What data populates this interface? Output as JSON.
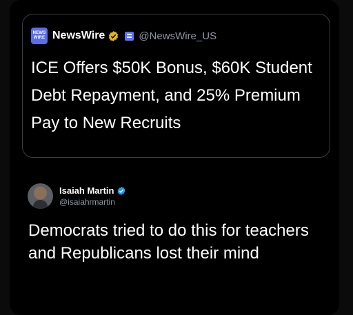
{
  "quoted_post": {
    "logo_text_top": "NEWS",
    "logo_text_bottom": "WIRE",
    "account_name": "NewsWire",
    "handle": "@NewsWire_US",
    "text": "ICE Offers $50K Bonus, $60K Student Debt Repayment, and 25% Premium Pay to New Recruits",
    "badge_icons": [
      "gold-verified-badge-icon",
      "affiliate-id-icon"
    ]
  },
  "post": {
    "author_name": "Isaiah Martin",
    "author_handle": "@isaiahrmartin",
    "badge_icon": "blue-verified-badge-icon",
    "text": "Democrats tried to do this for teachers and Republicans lost their mind"
  },
  "colors": {
    "background": "#000000",
    "text_primary": "#ffffff",
    "text_secondary": "#8b98a5",
    "gold_badge": "#e2b719",
    "blue_badge": "#1d9bf0",
    "border": "#3a3f44"
  }
}
